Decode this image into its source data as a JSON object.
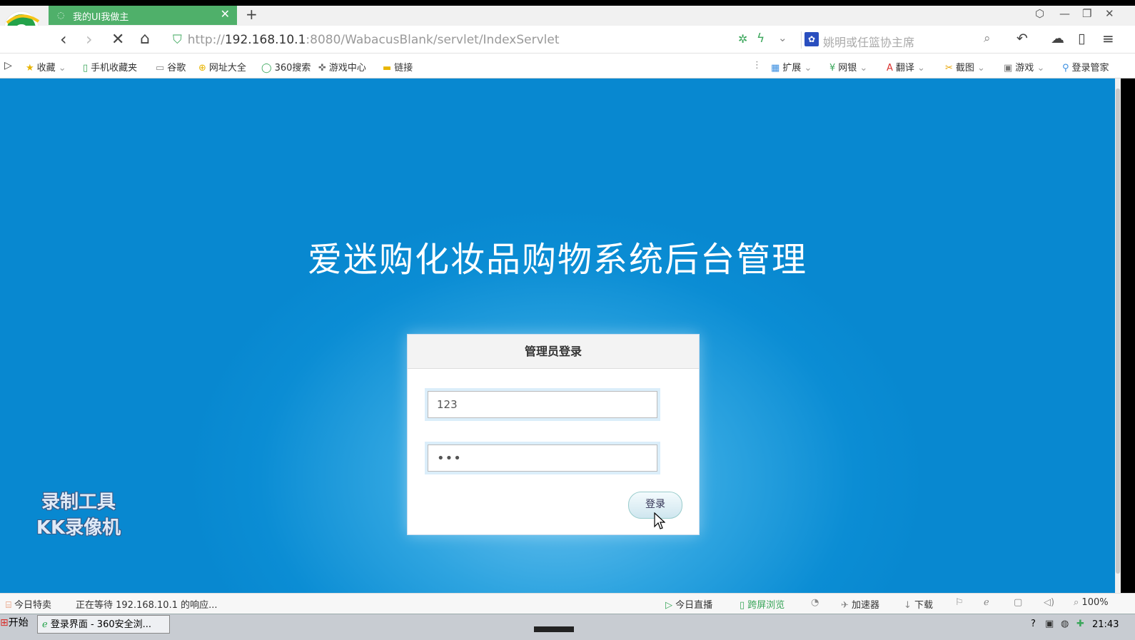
{
  "browser": {
    "tab_title": "我的UI我做主",
    "new_tab": "+",
    "url_scheme": "http://",
    "url_host": "192.168.10.1",
    "url_rest": ":8080/WabacusBlank/servlet/IndexServlet",
    "search_placeholder": "姚明或任篮协主席",
    "search_engine_icon": "baidu-paw-icon"
  },
  "bookmarks": [
    {
      "label": "收藏",
      "icon": "star-icon"
    },
    {
      "label": "手机收藏夹",
      "icon": "phone-icon"
    },
    {
      "label": "谷歌",
      "icon": "page-icon"
    },
    {
      "label": "网址大全",
      "icon": "plus-circle-icon"
    },
    {
      "label": "360搜索",
      "icon": "search-360-icon"
    },
    {
      "label": "游戏中心",
      "icon": "gamepad-icon"
    },
    {
      "label": "链接",
      "icon": "folder-icon"
    }
  ],
  "tools": [
    {
      "label": "扩展"
    },
    {
      "label": "网银"
    },
    {
      "label": "翻译"
    },
    {
      "label": "截图"
    },
    {
      "label": "游戏"
    },
    {
      "label": "登录管家"
    }
  ],
  "page": {
    "title": "爱迷购化妆品购物系统后台管理",
    "login": {
      "header": "管理员登录",
      "username_value": "123",
      "password_value": "•••",
      "submit_label": "登录"
    }
  },
  "watermark": {
    "line1": "录制工具",
    "line2": "KK录像机"
  },
  "status": {
    "today_deals": "今日特卖",
    "loading_text": "正在等待 192.168.10.1 的响应...",
    "live": "今日直播",
    "cross_screen": "跨屏浏览",
    "accelerator": "加速器",
    "download": "下载",
    "zoom": "100%"
  },
  "taskbar": {
    "start": "开始",
    "item": "登录界面 - 360安全浏...",
    "time": "21:43"
  }
}
